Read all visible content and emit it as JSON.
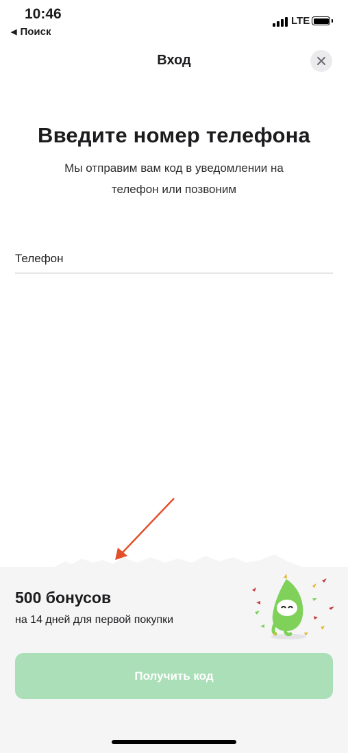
{
  "status_bar": {
    "time": "10:46",
    "back_app_label": "Поиск",
    "network": "LTE"
  },
  "header": {
    "title": "Вход"
  },
  "main": {
    "heading": "Введите номер телефона",
    "subtitle_line1": "Мы отправим вам код в уведомлении на",
    "subtitle_line2": "телефон или позвоним",
    "phone_label": "Телефон"
  },
  "promo": {
    "title": "500 бонусов",
    "subtitle": "на 14 дней для первой покупки"
  },
  "actions": {
    "get_code_label": "Получить код"
  },
  "colors": {
    "button_disabled": "#aadfb8",
    "accent_green": "#7fd15a",
    "annotation_arrow": "#e2502b",
    "panel_bg": "#f5f5f6"
  },
  "icons": [
    "back-triangle-icon",
    "signal-icon",
    "battery-icon",
    "close-icon",
    "mascot-icon",
    "arrow-icon"
  ]
}
